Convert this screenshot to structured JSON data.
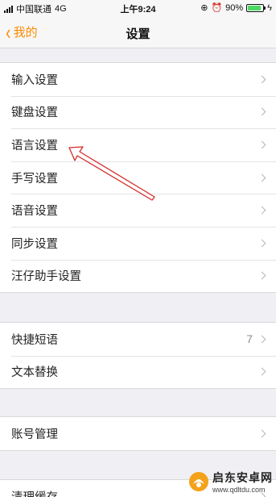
{
  "status": {
    "carrier": "中国联通",
    "network": "4G",
    "time": "上午9:24",
    "battery": "90%",
    "battery_level": 0.9
  },
  "nav": {
    "back_label": "我的",
    "title": "设置"
  },
  "groups": [
    [
      {
        "label": "输入设置"
      },
      {
        "label": "键盘设置"
      },
      {
        "label": "语言设置"
      },
      {
        "label": "手写设置"
      },
      {
        "label": "语音设置"
      },
      {
        "label": "同步设置"
      },
      {
        "label": "汪仔助手设置"
      }
    ],
    [
      {
        "label": "快捷短语",
        "value": "7"
      },
      {
        "label": "文本替换"
      }
    ],
    [
      {
        "label": "账号管理"
      }
    ],
    [
      {
        "label": "清理缓存"
      }
    ]
  ],
  "colors": {
    "accent": "#ff8a00",
    "annotation": "#d42a2a"
  },
  "watermark": {
    "name": "启东安卓网",
    "url": "www.qdltdu.com"
  }
}
